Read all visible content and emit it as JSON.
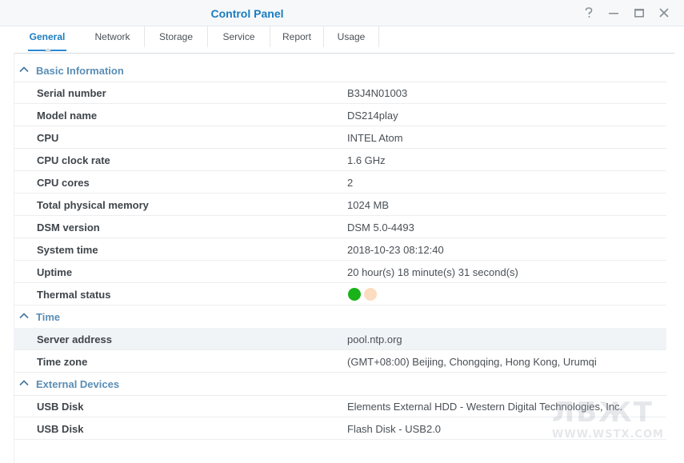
{
  "window": {
    "title": "Control Panel",
    "help_icon": "help-icon",
    "minimize_icon": "minimize-icon",
    "maximize_icon": "maximize-icon",
    "close_icon": "close-icon"
  },
  "tabs": [
    {
      "label": "General",
      "active": true
    },
    {
      "label": "Network",
      "active": false
    },
    {
      "label": "Storage",
      "active": false
    },
    {
      "label": "Service",
      "active": false
    },
    {
      "label": "Report",
      "active": false
    },
    {
      "label": "Usage",
      "active": false
    }
  ],
  "sections": {
    "basic": {
      "title": "Basic Information",
      "rows": [
        {
          "label": "Serial number",
          "value": "B3J4N01003"
        },
        {
          "label": "Model name",
          "value": "DS214play"
        },
        {
          "label": "CPU",
          "value": "INTEL Atom"
        },
        {
          "label": "CPU clock rate",
          "value": "1.6 GHz"
        },
        {
          "label": "CPU cores",
          "value": "2"
        },
        {
          "label": "Total physical memory",
          "value": "1024 MB"
        },
        {
          "label": "DSM version",
          "value": "DSM 5.0-4493"
        },
        {
          "label": "System time",
          "value": "2018-10-23 08:12:40"
        },
        {
          "label": "Uptime",
          "value": "20 hour(s) 18 minute(s) 31 second(s)"
        },
        {
          "label": "Thermal status",
          "value": ""
        }
      ]
    },
    "time": {
      "title": "Time",
      "rows": [
        {
          "label": "Server address",
          "value": "pool.ntp.org"
        },
        {
          "label": "Time zone",
          "value": "(GMT+08:00) Beijing, Chongqing, Hong Kong, Urumqi"
        }
      ]
    },
    "external": {
      "title": "External Devices",
      "rows": [
        {
          "label": "USB Disk",
          "value": "Elements External HDD - Western Digital Technologies, Inc."
        },
        {
          "label": "USB Disk",
          "value": "Flash Disk - USB2.0"
        }
      ]
    }
  },
  "thermal": {
    "normal_color": "#19b219",
    "warning_color": "#fcdcc0"
  },
  "colors": {
    "accent": "#1b7cc0",
    "section_title": "#5a8db5"
  },
  "watermark": {
    "big": "ЛБЖТ",
    "small": "WWW.WSTX.COM"
  }
}
